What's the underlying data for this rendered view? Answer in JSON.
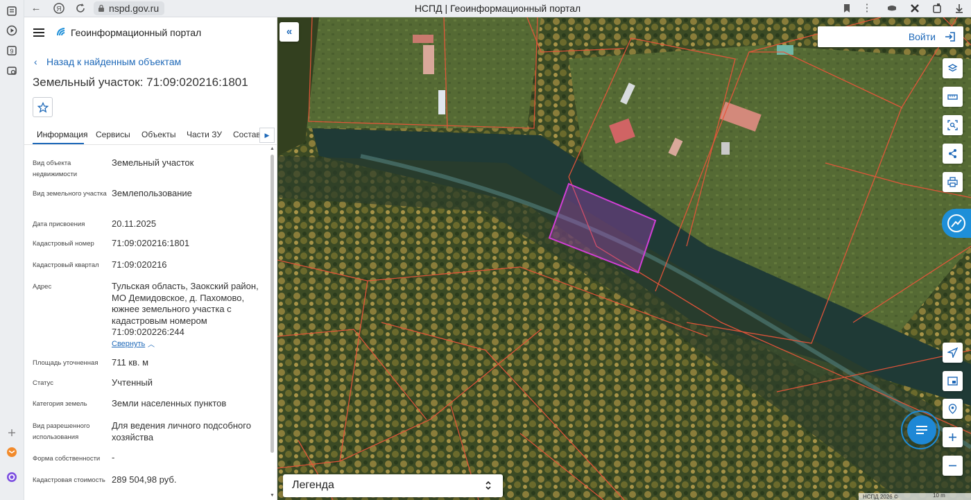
{
  "browser": {
    "url": "nspd.gov.ru",
    "tab_title": "НСПД | Геоинформационный портал"
  },
  "header": {
    "portal_title": "Геоинформационный портал"
  },
  "panel": {
    "back_label": "Назад к найденным объектам",
    "object_title": "Земельный участок: 71:09:020216:1801",
    "tabs": [
      {
        "label": "Информация",
        "active": true
      },
      {
        "label": "Сервисы"
      },
      {
        "label": "Объекты"
      },
      {
        "label": "Части ЗУ"
      },
      {
        "label": "Состав"
      }
    ],
    "rows": [
      {
        "label": "Вид объекта недвижимости",
        "value": "Земельный участок"
      },
      {
        "label": "Вид земельного участка",
        "value": "Землепользование"
      },
      {
        "label": "Дата присвоения",
        "value": "20.11.2025"
      },
      {
        "label": "Кадастровый номер",
        "value": "71:09:020216:1801"
      },
      {
        "label": "Кадастровый квартал",
        "value": "71:09:020216"
      },
      {
        "label": "Адрес",
        "value": "Тульская область, Заокский район, МО Демидовское, д. Пахомово, южнее земельного участка с кадастровым номером 71:09:020226:244"
      },
      {
        "label": "Площадь уточненная",
        "value": "711 кв. м"
      },
      {
        "label": "Статус",
        "value": "Учтенный"
      },
      {
        "label": "Категория земель",
        "value": "Земли населенных пунктов"
      },
      {
        "label": "Вид разрешенного использования",
        "value": "Для ведения личного подсобного хозяйства"
      },
      {
        "label": "Форма собственности",
        "value": "-"
      },
      {
        "label": "Кадастровая стоимость",
        "value": "289 504,98 руб."
      }
    ],
    "collapse_label": "Свернуть"
  },
  "map": {
    "login_label": "Войти",
    "legend_label": "Легенда",
    "copyright": "НСПД 2026 ©",
    "scale_label": "10 m",
    "highlight_color": "#d23fd6",
    "boundary_color": "#e8553a"
  }
}
